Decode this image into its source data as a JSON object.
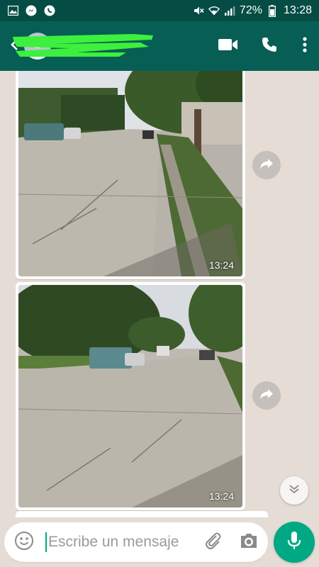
{
  "status_bar": {
    "battery": "72%",
    "time": "13:28",
    "icons": [
      "gallery-icon",
      "messenger-icon",
      "whatsapp-icon",
      "mute-icon",
      "wifi-icon",
      "signal-icon",
      "battery-icon"
    ]
  },
  "header": {
    "icons": [
      "back-arrow-icon",
      "avatar",
      "video-call-icon",
      "phone-icon",
      "more-vert-icon"
    ]
  },
  "messages": [
    {
      "type": "image",
      "time": "13:24"
    },
    {
      "type": "image",
      "time": "13:24"
    }
  ],
  "composer": {
    "placeholder": "Escribe un mensaje",
    "icons": [
      "emoji-icon",
      "attach-icon",
      "camera-icon",
      "mic-icon"
    ]
  },
  "colors": {
    "header": "#075e54",
    "status_bar": "#054d44",
    "accent": "#00a884",
    "chat_bg": "#e5ddd5"
  }
}
